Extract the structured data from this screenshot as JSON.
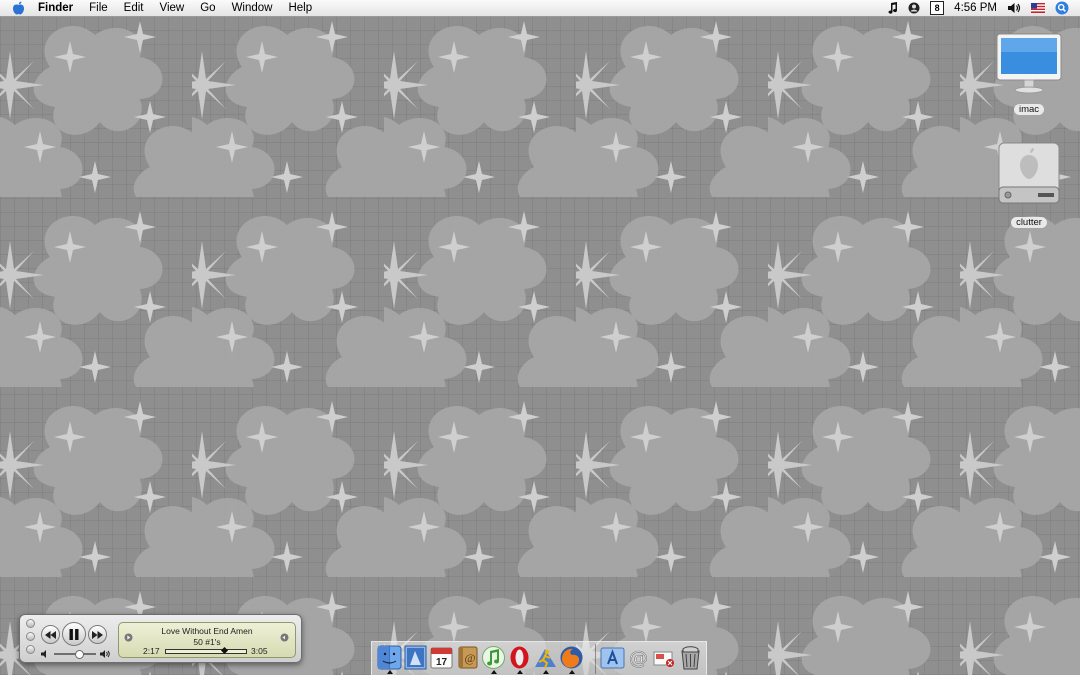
{
  "menubar": {
    "app_name": "Finder",
    "menus": [
      "File",
      "Edit",
      "View",
      "Go",
      "Window",
      "Help"
    ],
    "status": {
      "music_icon": "music-note-icon",
      "user_icon": "fast-user-switch-icon",
      "battery_text": "8",
      "clock": "4:56 PM",
      "volume_icon": "volume-icon",
      "flag_icon": "us-flag-icon",
      "spotlight_icon": "spotlight-search-icon"
    }
  },
  "desktop": {
    "icons": [
      {
        "label": "imac",
        "icon": "imac-computer-icon"
      },
      {
        "label": "clutter",
        "icon": "hard-drive-icon"
      }
    ]
  },
  "itunes_mini": {
    "song": "Love Without End Amen",
    "album": "50 #1's",
    "elapsed": "2:17",
    "total": "3:05",
    "progress": 0.74,
    "volume": 0.6
  },
  "dock": {
    "items": [
      {
        "name": "Finder",
        "icon": "finder-icon",
        "running": true
      },
      {
        "name": "Mail",
        "icon": "mail-stamp-icon",
        "running": false
      },
      {
        "name": "iCal",
        "icon": "ical-calendar-icon",
        "running": false,
        "badge": "17"
      },
      {
        "name": "Address Book",
        "icon": "address-book-icon",
        "running": false
      },
      {
        "name": "iTunes",
        "icon": "itunes-icon",
        "running": true
      },
      {
        "name": "Opera",
        "icon": "opera-icon",
        "running": true
      },
      {
        "name": "Transmit",
        "icon": "transmit-runner-icon",
        "running": true
      },
      {
        "name": "Firefox",
        "icon": "firefox-icon",
        "running": true
      },
      {
        "name": "Applications",
        "icon": "applications-folder-icon",
        "running": false
      },
      {
        "name": "Mail Alias",
        "icon": "at-sign-icon",
        "running": false
      },
      {
        "name": "Documents",
        "icon": "documents-stack-icon",
        "running": false
      },
      {
        "name": "Trash",
        "icon": "trash-full-icon",
        "running": false
      }
    ]
  }
}
